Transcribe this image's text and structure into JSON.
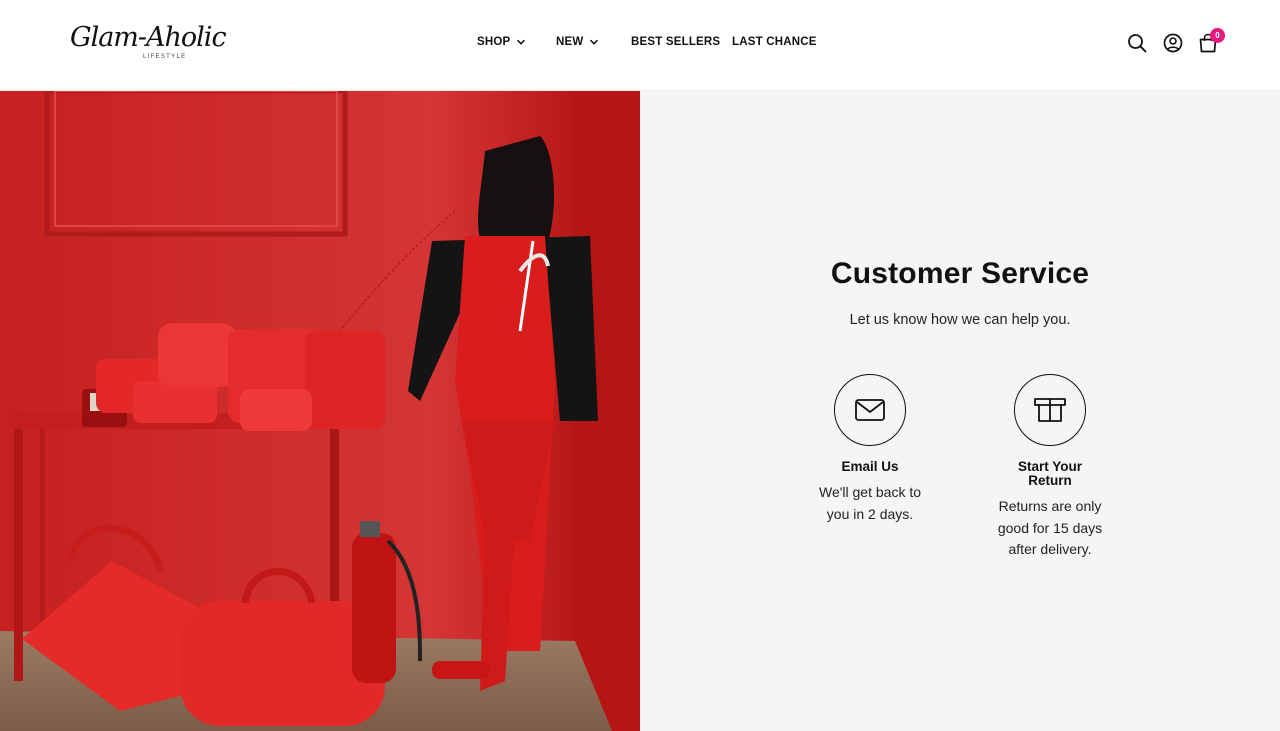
{
  "brand": {
    "logo_text": "Glam-Aholic",
    "logo_sub": "LIFESTYLE"
  },
  "nav": {
    "shop": "SHOP",
    "new": "NEW",
    "best_sellers": "BEST SELLERS",
    "last_chance": "LAST CHANCE"
  },
  "header_icons": [
    "search-icon",
    "account-icon",
    "shopping-bag-icon"
  ],
  "cart": {
    "count": "0"
  },
  "colors": {
    "accent": "#e6197e",
    "hero_red": "#d42a2a",
    "panel_bg": "#f4f5f7"
  },
  "customer_service": {
    "title": "Customer Service",
    "subtitle": "Let us know how we can help you.",
    "cards": [
      {
        "icon": "envelope-icon",
        "title": "Email Us",
        "text": "We'll get back to you in 2 days."
      },
      {
        "icon": "box-icon",
        "title": "Start Your Return",
        "text": "Returns are only good for 15 days after delivery."
      }
    ]
  }
}
